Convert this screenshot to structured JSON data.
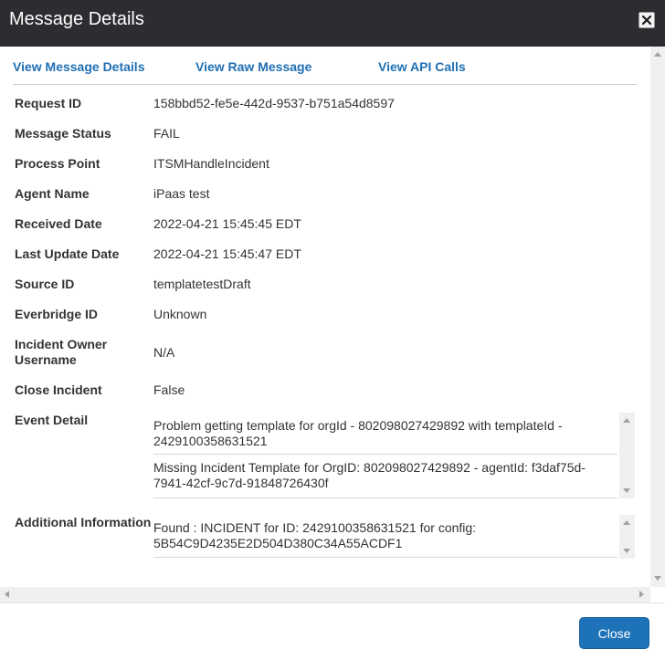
{
  "dialog": {
    "title": "Message Details",
    "close_icon_glyph": "✕"
  },
  "tabs": [
    {
      "label": "View Message Details"
    },
    {
      "label": "View Raw Message"
    },
    {
      "label": "View API Calls"
    }
  ],
  "fields": {
    "request_id": {
      "label": "Request ID",
      "value": "158bbd52-fe5e-442d-9537-b751a54d8597"
    },
    "message_status": {
      "label": "Message Status",
      "value": "FAIL"
    },
    "process_point": {
      "label": "Process Point",
      "value": "ITSMHandleIncident"
    },
    "agent_name": {
      "label": "Agent Name",
      "value": "iPaas test"
    },
    "received_date": {
      "label": "Received Date",
      "value": "2022-04-21 15:45:45 EDT"
    },
    "last_update_date": {
      "label": "Last Update Date",
      "value": "2022-04-21 15:45:47 EDT"
    },
    "source_id": {
      "label": "Source ID",
      "value": "templatetestDraft"
    },
    "everbridge_id": {
      "label": "Everbridge ID",
      "value": "Unknown"
    },
    "incident_owner_username": {
      "label_line1": "Incident Owner",
      "label_line2": "Username",
      "value": "N/A"
    },
    "close_incident": {
      "label": "Close Incident",
      "value": "False"
    }
  },
  "event_detail": {
    "label": "Event Detail",
    "entries": [
      {
        "line1": "Problem getting template for orgId - 802098027429892 with templateId -",
        "line2": "2429100358631521"
      },
      {
        "line1": "Missing Incident Template for OrgID: 802098027429892 - agentId: f3daf75d-",
        "line2": "7941-42cf-9c7d-91848726430f"
      }
    ]
  },
  "additional_information": {
    "label": "Additional Information",
    "entries": [
      {
        "line1": "Found : INCIDENT for ID: 2429100358631521 for config:",
        "line2": "5B54C9D4235E2D504D380C34A55ACDF1"
      }
    ]
  },
  "footer": {
    "close_label": "Close"
  },
  "colors": {
    "titlebar": "#2b2d30",
    "link": "#1f6fb3",
    "primary_button": "#1e73b8"
  }
}
